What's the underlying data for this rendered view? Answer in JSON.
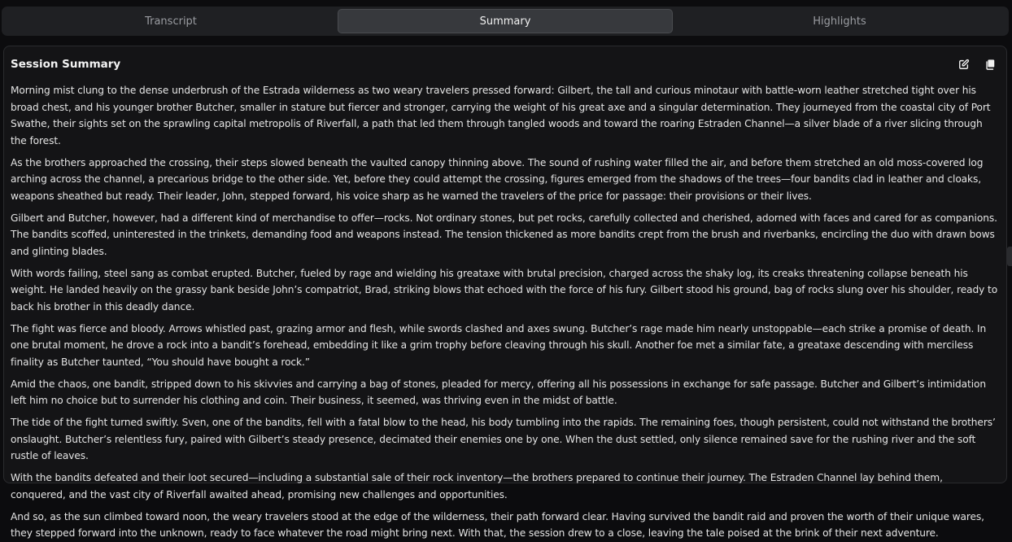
{
  "tabs": [
    {
      "label": "Transcript"
    },
    {
      "label": "Summary"
    },
    {
      "label": "Highlights"
    }
  ],
  "active_tab": "Summary",
  "panel": {
    "title": "Session Summary",
    "icons": [
      "edit-icon",
      "copy-icon"
    ]
  },
  "paragraphs": [
    "Morning mist clung to the dense underbrush of the Estrada wilderness as two weary travelers pressed forward: Gilbert, the tall and curious minotaur with battle-worn leather stretched tight over his broad chest, and his younger brother Butcher, smaller in stature but fiercer and stronger, carrying the weight of his great axe and a singular determination. They journeyed from the coastal city of Port Swathe, their sights set on the sprawling capital metropolis of Riverfall, a path that led them through tangled woods and toward the roaring Estraden Channel—a silver blade of a river slicing through the forest.",
    "As the brothers approached the crossing, their steps slowed beneath the vaulted canopy thinning above. The sound of rushing water filled the air, and before them stretched an old moss-covered log arching across the channel, a precarious bridge to the other side. Yet, before they could attempt the crossing, figures emerged from the shadows of the trees—four bandits clad in leather and cloaks, weapons sheathed but ready. Their leader, John, stepped forward, his voice sharp as he warned the travelers of the price for passage: their provisions or their lives.",
    "Gilbert and Butcher, however, had a different kind of merchandise to offer—rocks. Not ordinary stones, but pet rocks, carefully collected and cherished, adorned with faces and cared for as companions. The bandits scoffed, uninterested in the trinkets, demanding food and weapons instead. The tension thickened as more bandits crept from the brush and riverbanks, encircling the duo with drawn bows and glinting blades.",
    "With words failing, steel sang as combat erupted. Butcher, fueled by rage and wielding his greataxe with brutal precision, charged across the shaky log, its creaks threatening collapse beneath his weight. He landed heavily on the grassy bank beside John’s compatriot, Brad, striking blows that echoed with the force of his fury. Gilbert stood his ground, bag of rocks slung over his shoulder, ready to back his brother in this deadly dance.",
    "The fight was fierce and bloody. Arrows whistled past, grazing armor and flesh, while swords clashed and axes swung. Butcher’s rage made him nearly unstoppable—each strike a promise of death. In one brutal moment, he drove a rock into a bandit’s forehead, embedding it like a grim trophy before cleaving through his skull. Another foe met a similar fate, a greataxe descending with merciless finality as Butcher taunted, “You should have bought a rock.”",
    "Amid the chaos, one bandit, stripped down to his skivvies and carrying a bag of stones, pleaded for mercy, offering all his possessions in exchange for safe passage. Butcher and Gilbert’s intimidation left him no choice but to surrender his clothing and coin. Their business, it seemed, was thriving even in the midst of battle.",
    "The tide of the fight turned swiftly. Sven, one of the bandits, fell with a fatal blow to the head, his body tumbling into the rapids. The remaining foes, though persistent, could not withstand the brothers’ onslaught. Butcher’s relentless fury, paired with Gilbert’s steady presence, decimated their enemies one by one. When the dust settled, only silence remained save for the rushing river and the soft rustle of leaves.",
    "With the bandits defeated and their loot secured—including a substantial sale of their rock inventory—the brothers prepared to continue their journey. The Estraden Channel lay behind them, conquered, and the vast city of Riverfall awaited ahead, promising new challenges and opportunities.",
    "And so, as the sun climbed toward noon, the weary travelers stood at the edge of the wilderness, their path forward clear. Having survived the bandit raid and proven the worth of their unique wares, they stepped forward into the unknown, ready to face whatever the road might bring next. With that, the session drew to a close, leaving the tale poised at the brink of their next adventure."
  ]
}
